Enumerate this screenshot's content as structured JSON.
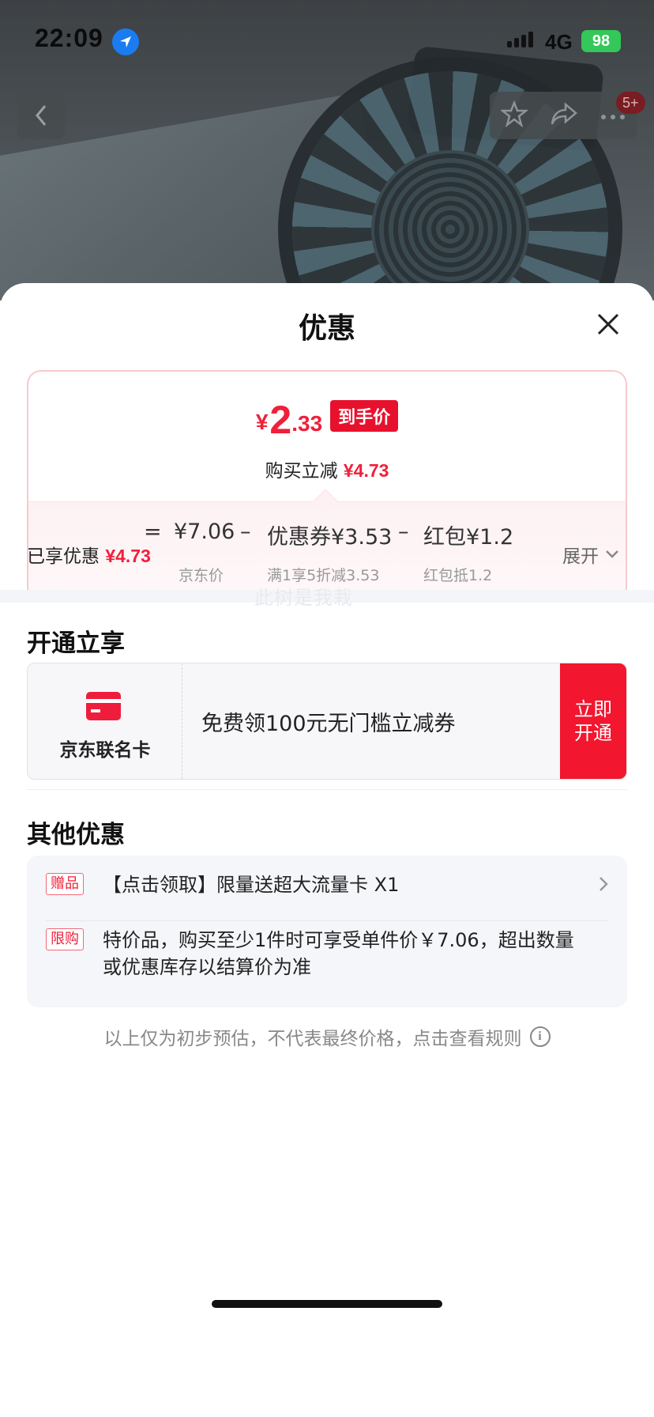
{
  "status_bar": {
    "time": "22:09",
    "network": "4G",
    "battery": "98"
  },
  "background_nav": {
    "badge": "5+"
  },
  "sheet": {
    "title": "优惠"
  },
  "price_card": {
    "currency": "¥",
    "price_int": "2",
    "price_dec": ".33",
    "price_tag": "到手价",
    "reduce_label": "购买立减",
    "reduce_value": "¥4.73",
    "formula": {
      "eq": "=",
      "jd_price": "¥7.06",
      "minus1": "–",
      "coupon": "优惠券¥3.53",
      "minus2": "–",
      "redpack": "红包¥1.2"
    },
    "formula_sub": {
      "jd_price_label": "京东价",
      "coupon_label": "满1享5折减3.53",
      "redpack_label": "红包抵1.2"
    }
  },
  "enjoyed": {
    "label": "已享优惠",
    "value": "¥4.73",
    "expand_label": "展开"
  },
  "watermark": "此树是我栽",
  "open_section": {
    "title": "开通立享",
    "card_name": "京东联名卡",
    "card_desc": "免费领100元无门槛立减券",
    "cta_line1": "立即",
    "cta_line2": "开通"
  },
  "other_section": {
    "title": "其他优惠",
    "offers": [
      {
        "tag": "赠品",
        "text": "【点击领取】限量送超大流量卡 X1"
      },
      {
        "tag": "限购",
        "text": "特价品，购买至少1件时可享受单件价￥7.06，超出数量或优惠库存以结算价为准"
      }
    ]
  },
  "footer_note": "以上仅为初步预估，不代表最终价格，点击查看规则",
  "colors": {
    "accent_red": "#f0203a",
    "tag_red": "#e8112d",
    "battery_green": "#34c759",
    "location_blue": "#1a7cf0"
  }
}
